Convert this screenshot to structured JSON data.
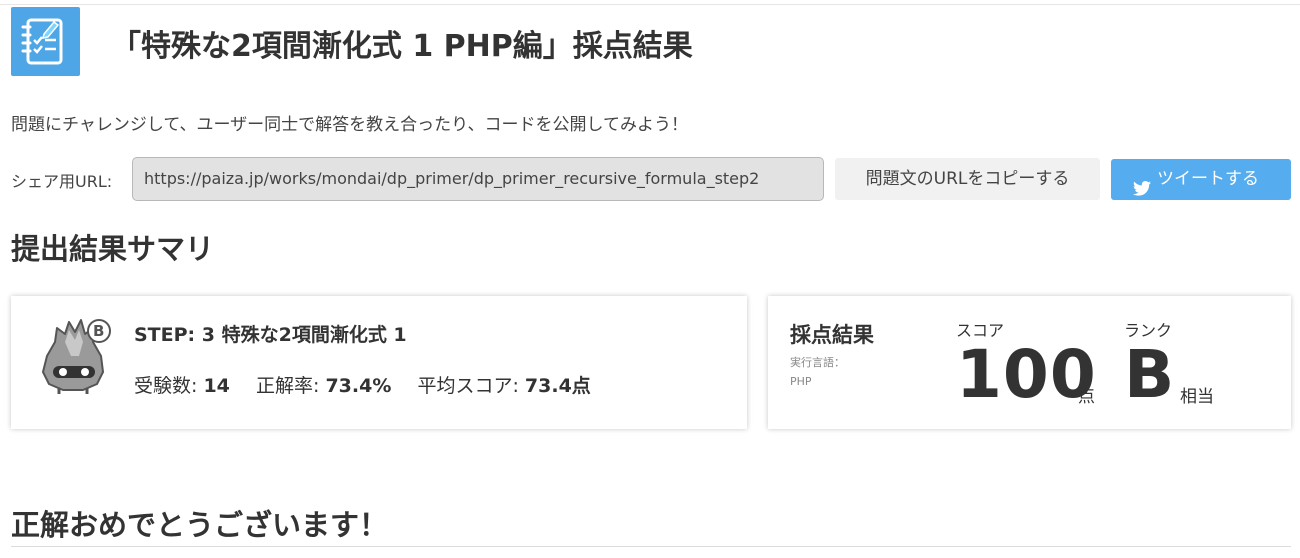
{
  "header": {
    "icon": "notebook-checklist-icon",
    "title": "「特殊な2項間漸化式 1 PHP編」採点結果"
  },
  "lead_text": "問題にチャレンジして、ユーザー同士で解答を教え合ったり、コードを公開してみよう！",
  "share": {
    "label": "シェア用URL:",
    "url": "https://paiza.jp/works/mondai/dp_primer/dp_primer_recursive_formula_step2",
    "copy_button": "問題文のURLをコピーする",
    "tweet_button": "ツイートする",
    "tweet_icon": "twitter-bird-icon",
    "tweet_color": "#55acee"
  },
  "summary": {
    "title": "提出結果サマリ",
    "mascot_icon": "rank-b-mascot-icon",
    "mascot_badge": "B",
    "step_title": "STEP: 3 特殊な2項間漸化式 1",
    "stats": {
      "examinees_label": "受験数:",
      "examinees_value": "14",
      "accuracy_label": "正解率:",
      "accuracy_value": "73.4%",
      "avg_score_label": "平均スコア:",
      "avg_score_value": "73.4点"
    }
  },
  "result": {
    "heading": "採点結果",
    "language_label": "実行言語：",
    "language_value": "PHP",
    "score_label": "スコア",
    "score_value": "100",
    "score_unit": "点",
    "rank_label": "ランク",
    "rank_value": "B",
    "rank_unit": "相当"
  },
  "congrats": "正解おめでとうございます！"
}
